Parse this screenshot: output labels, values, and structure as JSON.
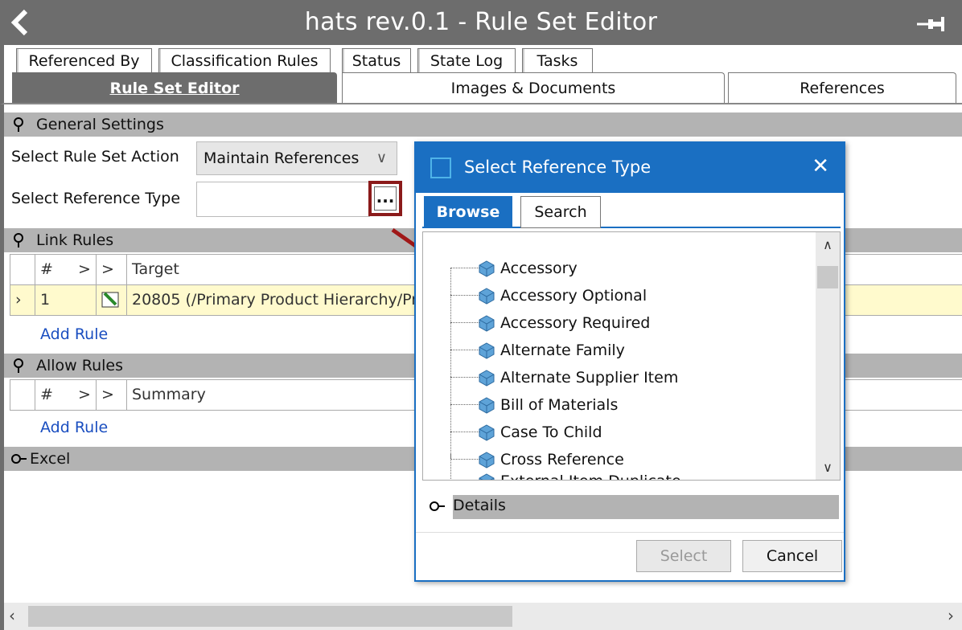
{
  "window": {
    "title": "hats rev.0.1 - Rule Set Editor"
  },
  "tabs_row1": [
    "Referenced By",
    "Classification Rules",
    "Status",
    "State Log",
    "Tasks"
  ],
  "tabs_row2": {
    "active": "Rule Set Editor",
    "others": [
      "Images & Documents",
      "References"
    ]
  },
  "general_settings": {
    "header": "General Settings",
    "action_label": "Select Rule Set Action",
    "action_value": "Maintain References",
    "reftype_label": "Select Reference Type",
    "ellipsis": "..."
  },
  "link_rules": {
    "header": "Link Rules",
    "columns": [
      "#",
      ">",
      ">",
      "Target"
    ],
    "rows": [
      {
        "index": "1",
        "target": "20805 (/Primary Product Hierarchy/Pr"
      }
    ],
    "add_rule": "Add Rule"
  },
  "allow_rules": {
    "header": "Allow Rules",
    "columns": [
      "#",
      ">",
      ">",
      "Summary"
    ],
    "add_rule": "Add Rule"
  },
  "excel": {
    "header": "Excel"
  },
  "dialog": {
    "title": "Select Reference Type",
    "close": "✕",
    "tabs": [
      "Browse",
      "Search"
    ],
    "items": [
      "Accessory",
      "Accessory Optional",
      "Accessory Required",
      "Alternate Family",
      "Alternate Supplier Item",
      "Bill of Materials",
      "Case To Child",
      "Cross Reference",
      "External Item Duplicate"
    ],
    "details": "Details",
    "select_button": "Select",
    "cancel_button": "Cancel"
  },
  "colors": {
    "titlebar": "#6d6d6d",
    "dialog_accent": "#1a6fc2",
    "highlight": "#8b1a1a",
    "link": "#1a4ec0",
    "selected_row": "#fffacd"
  }
}
